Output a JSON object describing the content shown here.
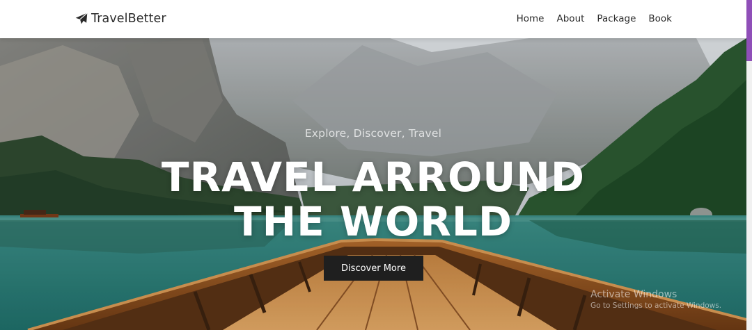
{
  "navbar": {
    "brand_icon": "paper-plane-icon",
    "brand_name": "TravelBetter",
    "links": [
      {
        "label": "Home"
      },
      {
        "label": "About"
      },
      {
        "label": "Package"
      },
      {
        "label": "Book"
      }
    ]
  },
  "hero": {
    "tagline": "Explore, Discover, Travel",
    "title_line1": "TRAVEL ARROUND",
    "title_line2": "THE WORLD",
    "button_label": "Discover More",
    "background": "mountain-lake-boat-photo"
  },
  "watermark": {
    "title": "Activate Windows",
    "subtitle": "Go to Settings to activate Windows."
  },
  "colors": {
    "navbar_bg": "#ffffff",
    "button_bg": "#1f1f1f",
    "scroll_thumb": "#8f4fb8",
    "water": "#2b8a85"
  }
}
